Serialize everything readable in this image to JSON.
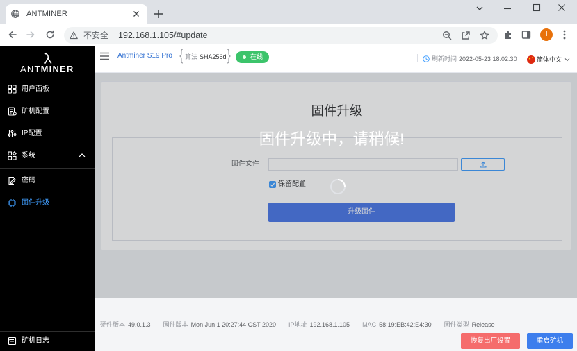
{
  "browser": {
    "tab_title": "ANTMINER",
    "security_label": "不安全",
    "url": "192.168.1.105/#update",
    "profile_initial": "I",
    "icons": [
      "globe-icon",
      "close-tab-icon",
      "new-tab-icon",
      "tab-search-chevron-icon",
      "minimize-icon",
      "maximize-icon",
      "close-window-icon",
      "back-arrow-icon",
      "forward-arrow-icon",
      "reload-icon",
      "warning-icon",
      "zoom-icon",
      "share-icon",
      "star-icon",
      "extensions-puzzle-icon",
      "side-panel-icon",
      "kebab-menu-icon"
    ]
  },
  "sidebar": {
    "logo_ant": "ANT",
    "logo_miner": "MINER",
    "items": [
      {
        "label": "用户面板",
        "icon": "dashboard-icon"
      },
      {
        "label": "矿机配置",
        "icon": "miner-config-icon"
      },
      {
        "label": "IP配置",
        "icon": "sliders-icon"
      },
      {
        "label": "系统",
        "icon": "system-icon",
        "expanded": true
      }
    ],
    "sub_items": [
      {
        "label": "密码",
        "icon": "password-edit-icon",
        "active": false
      },
      {
        "label": "固件升级",
        "icon": "chip-icon",
        "active": true
      }
    ],
    "footer_item": {
      "label": "矿机日志",
      "icon": "log-icon"
    }
  },
  "header": {
    "model": "Antminer S19 Pro",
    "algo_label": "算法",
    "algo_value": "SHA256d",
    "status": "在线",
    "refresh_label": "刷新时间",
    "refresh_time": "2022-05-23 18:02:30",
    "language": "简体中文",
    "language_icon": "china-flag-icon"
  },
  "upgrade": {
    "title": "固件升级",
    "loading_text": "固件升级中，请稍候!",
    "file_label": "固件文件",
    "file_value": "",
    "upload_icon": "upload-icon",
    "keep_config_label": "保留配置",
    "keep_config_checked": true,
    "submit_label": "升级固件"
  },
  "footer": {
    "info": [
      {
        "label": "硬件版本",
        "value": "49.0.1.3"
      },
      {
        "label": "固件版本",
        "value": "Mon Jun 1 20:27:44 CST 2020"
      },
      {
        "label": "IP地址",
        "value": "192.168.1.105"
      },
      {
        "label": "MAC",
        "value": "58:19:EB:42:E4:30"
      },
      {
        "label": "固件类型",
        "value": "Release"
      }
    ],
    "reset_label": "恢复出厂设置",
    "reboot_label": "重启矿机"
  },
  "colors": {
    "accent": "#409eff",
    "status_online": "#3cc46b",
    "danger": "#f56c6c",
    "primary_button": "#4a77e8",
    "reboot_button": "#3d7eed",
    "sidebar_bg": "#000000"
  }
}
